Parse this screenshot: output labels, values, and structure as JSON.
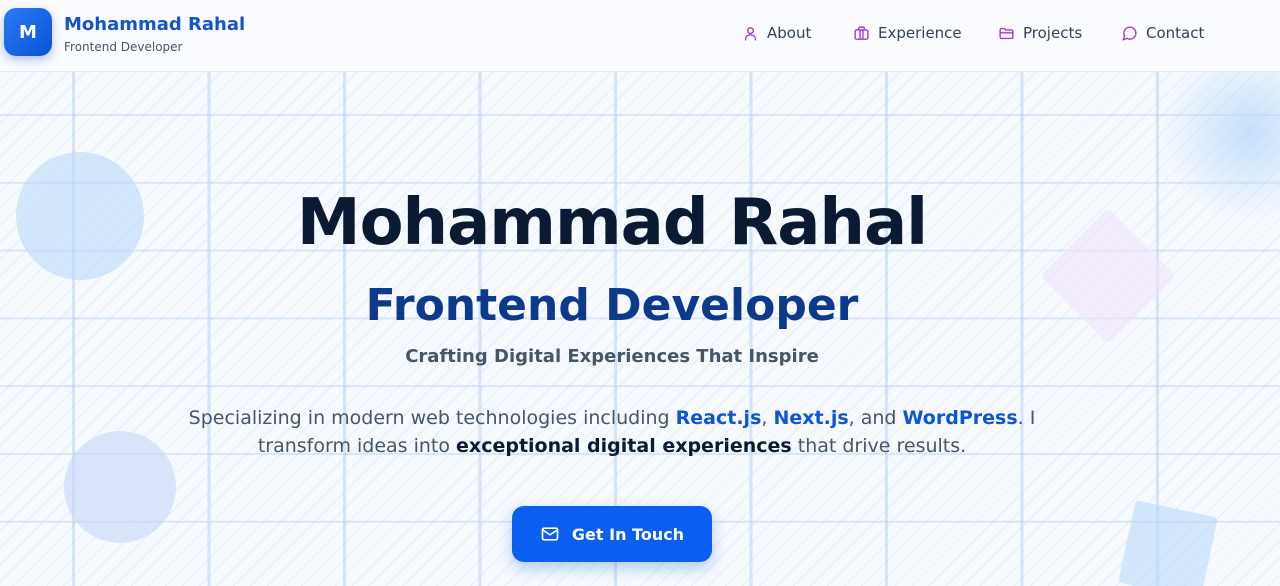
{
  "header": {
    "logo_letter": "M",
    "brand_name": "Mohammad Rahal",
    "brand_subtitle": "Frontend Developer",
    "nav": [
      {
        "label": "About",
        "icon": "user-icon"
      },
      {
        "label": "Experience",
        "icon": "briefcase-icon"
      },
      {
        "label": "Projects",
        "icon": "folder-icon"
      },
      {
        "label": "Contact",
        "icon": "message-circle-icon"
      }
    ]
  },
  "hero": {
    "title": "Mohammad Rahal",
    "role": "Frontend Developer",
    "tagline": "Crafting Digital Experiences That Inspire",
    "description": {
      "part1": "Specializing in modern web technologies including ",
      "tech1": "React.js",
      "sep1": ", ",
      "tech2": "Next.js",
      "sep2": ", and ",
      "tech3": "WordPress",
      "part2": ". I transform ideas into ",
      "highlight": "exceptional digital experiences",
      "part3": " that drive results."
    },
    "cta_label": "Get In Touch",
    "cta_icon": "mail-icon"
  },
  "colors": {
    "brand_blue": "#1456c6",
    "cta_blue": "#0a5ff0",
    "nav_icon_purple": "#a23ad8",
    "title_dark": "#0b1a33",
    "role_blue": "#0b3a8c"
  }
}
